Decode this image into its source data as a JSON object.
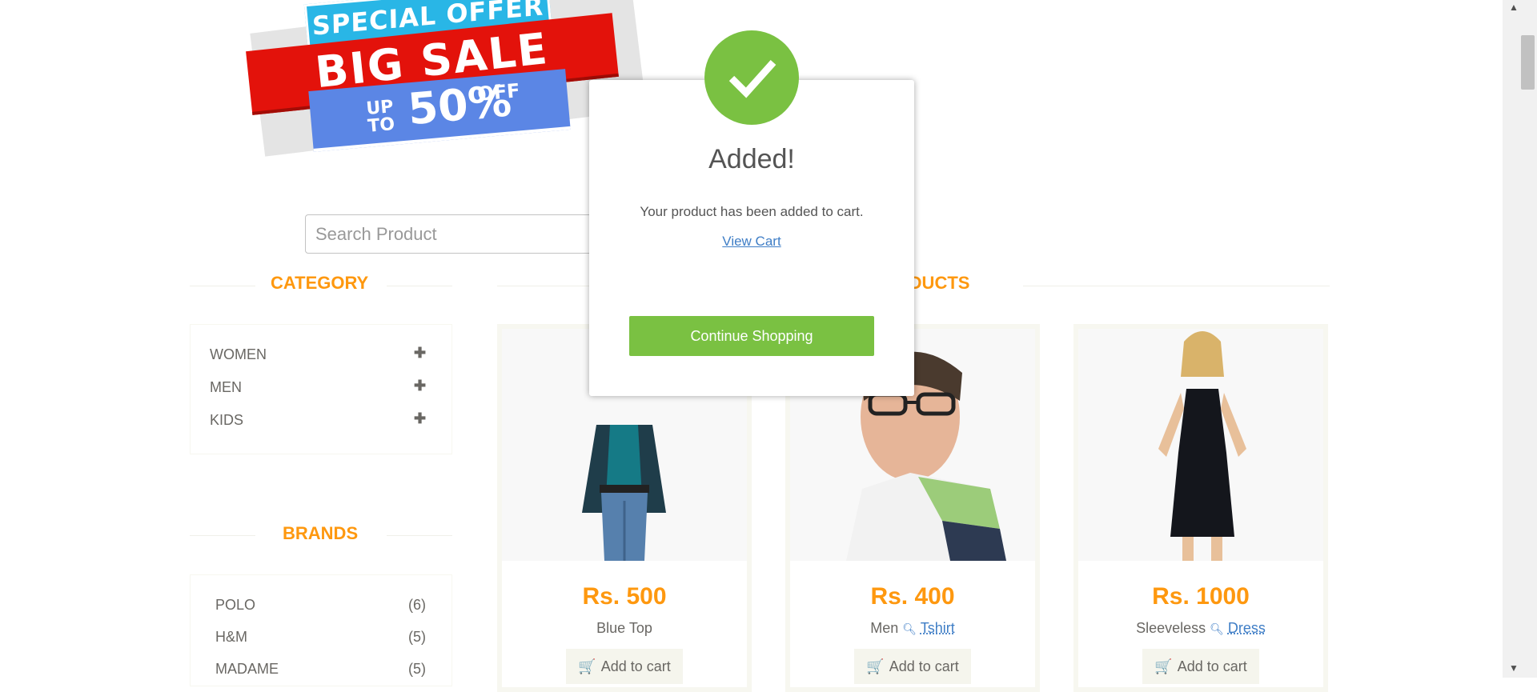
{
  "banner": {
    "line1": "SPECIAL OFFER",
    "line2": "BIG SALE",
    "upto": "UP TO",
    "percent": "50%",
    "off": "OFF"
  },
  "search": {
    "placeholder": "Search Product"
  },
  "sidebar": {
    "category_title": "CATEGORY",
    "categories": [
      {
        "label": "WOMEN",
        "icon": "plus-icon"
      },
      {
        "label": "MEN",
        "icon": "plus-icon"
      },
      {
        "label": "KIDS",
        "icon": "plus-icon"
      }
    ],
    "brands_title": "BRANDS",
    "brands": [
      {
        "label": "POLO",
        "count": "(6)"
      },
      {
        "label": "H&M",
        "count": "(5)"
      },
      {
        "label": "MADAME",
        "count": "(5)"
      }
    ]
  },
  "products_title": "PRODUCTS",
  "products": [
    {
      "price": "Rs. 500",
      "name": "Blue Top",
      "add_label": "Add to cart"
    },
    {
      "price": "Rs. 400",
      "name": "Men",
      "link": "Tshirt",
      "add_label": "Add to cart"
    },
    {
      "price": "Rs. 1000",
      "name": "Sleeveless",
      "link": "Dress",
      "add_label": "Add to cart"
    }
  ],
  "modal": {
    "title": "Added!",
    "text": "Your product has been added to cart.",
    "link": "View Cart",
    "button": "Continue Shopping",
    "icon": "check-icon"
  },
  "colors": {
    "accent_orange": "#fe980f",
    "success_green": "#7ac142",
    "link_blue": "#3f7ec6"
  }
}
